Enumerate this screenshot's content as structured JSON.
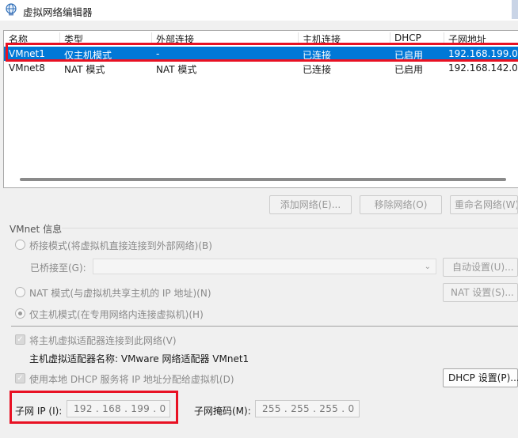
{
  "window": {
    "title": "虚拟网络编辑器"
  },
  "table": {
    "headers": [
      "名称",
      "类型",
      "外部连接",
      "主机连接",
      "DHCP",
      "子网地址"
    ],
    "rows": [
      {
        "name": "VMnet1",
        "type": "仅主机模式",
        "external": "-",
        "host": "已连接",
        "dhcp": "已启用",
        "subnet": "192.168.199.0",
        "selected": true
      },
      {
        "name": "VMnet8",
        "type": "NAT 模式",
        "external": "NAT 模式",
        "host": "已连接",
        "dhcp": "已启用",
        "subnet": "192.168.142.0",
        "selected": false
      }
    ]
  },
  "buttons": {
    "add_network": "添加网络(E)...",
    "remove_network": "移除网络(O)",
    "rename_network": "重命名网络(W)...",
    "auto_settings": "自动设置(U)...",
    "nat_settings": "NAT 设置(S)...",
    "dhcp_settings": "DHCP 设置(P)..."
  },
  "vmnet_info": {
    "group_label": "VMnet 信息",
    "bridged_label": "桥接模式(将虚拟机直接连接到外部网络)(B)",
    "bridged_to_label": "已桥接至(G):",
    "bridged_to_value": "",
    "nat_label": "NAT 模式(与虚拟机共享主机的 IP 地址)(N)",
    "hostonly_label": "仅主机模式(在专用网络内连接虚拟机)(H)",
    "selected_mode": "hostonly",
    "connect_adapter_label": "将主机虚拟适配器连接到此网络(V)",
    "connect_adapter_checked": true,
    "adapter_name_label": "主机虚拟适配器名称: VMware 网络适配器 VMnet1",
    "use_dhcp_label": "使用本地 DHCP 服务将 IP 地址分配给虚拟机(D)",
    "use_dhcp_checked": true,
    "subnet_ip_label": "子网 IP (I):",
    "subnet_ip_value": "192 . 168 . 199 .  0",
    "subnet_mask_label": "子网掩码(M):",
    "subnet_mask_value": "255 . 255 . 255 .  0"
  },
  "colors": {
    "selection": "#0078d7",
    "highlight_box": "#e81123",
    "disabled_text": "#8a8a8a"
  },
  "icons": {
    "title": "globe-network-icon",
    "combo_arrow": "chevron-down-icon",
    "check": "checkmark-icon"
  }
}
